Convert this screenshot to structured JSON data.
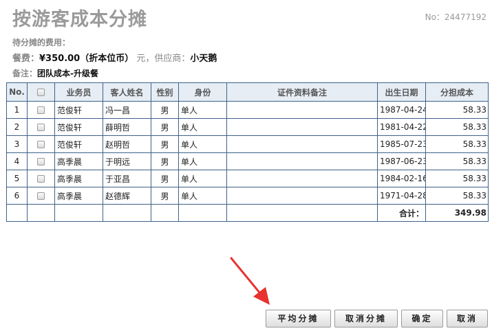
{
  "header": {
    "title": "按游客成本分摊",
    "doc_no": "No：24477192"
  },
  "info": {
    "pending_label": "待分摊的费用：",
    "meal_label": "餐费：",
    "amount": "¥350.00（折本位币）",
    "unit_text": "元，供应商：",
    "supplier": "小天鹅",
    "note_label": "备注：",
    "note": "团队成本-升级餐"
  },
  "table": {
    "columns": [
      "No.",
      "",
      "业务员",
      "客人姓名",
      "性别",
      "身份",
      "证件资料备注",
      "出生日期",
      "分担成本"
    ],
    "rows": [
      {
        "no": "1",
        "agent": "范俊轩",
        "guest": "冯一昌",
        "gender": "男",
        "identity": "单人",
        "remark": "",
        "birth": "1987-04-24",
        "cost": "58.33"
      },
      {
        "no": "2",
        "agent": "范俊轩",
        "guest": "薛明哲",
        "gender": "男",
        "identity": "单人",
        "remark": "",
        "birth": "1981-04-22",
        "cost": "58.33"
      },
      {
        "no": "3",
        "agent": "范俊轩",
        "guest": "赵明哲",
        "gender": "男",
        "identity": "单人",
        "remark": "",
        "birth": "1985-07-23",
        "cost": "58.33"
      },
      {
        "no": "4",
        "agent": "高季晨",
        "guest": "于明远",
        "gender": "男",
        "identity": "单人",
        "remark": "",
        "birth": "1987-06-23",
        "cost": "58.33"
      },
      {
        "no": "5",
        "agent": "高季晨",
        "guest": "于亚昌",
        "gender": "男",
        "identity": "单人",
        "remark": "",
        "birth": "1984-02-16",
        "cost": "58.33"
      },
      {
        "no": "6",
        "agent": "高季晨",
        "guest": "赵德辉",
        "gender": "男",
        "identity": "单人",
        "remark": "",
        "birth": "1971-04-28",
        "cost": "58.33"
      }
    ],
    "total_label": "合计：",
    "total_value": "349.98"
  },
  "buttons": {
    "average": "平均分摊",
    "cancel_share": "取消分摊",
    "confirm": "确定",
    "cancel": "取消"
  },
  "colors": {
    "grid_border": "#3f5f8a",
    "arrow": "#e8322f"
  },
  "icons": [
    "checkbox-icon",
    "arrow-pointer-icon"
  ]
}
